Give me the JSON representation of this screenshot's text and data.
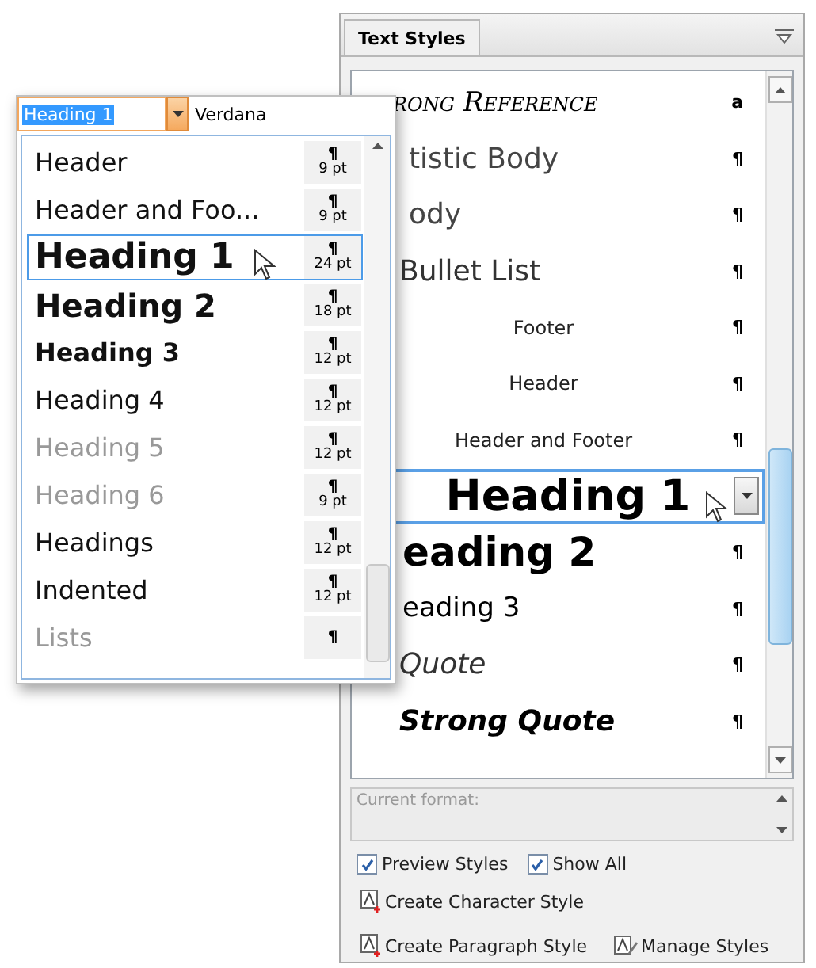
{
  "panel": {
    "title": "Text Styles",
    "rows": [
      {
        "kind": "small-caps",
        "text": "rong Reference",
        "mark": "a",
        "selected": false
      },
      {
        "kind": "light",
        "text": "tistic Body",
        "mark": "¶",
        "selected": false
      },
      {
        "kind": "light",
        "text": "ody",
        "mark": "¶",
        "selected": false
      },
      {
        "kind": "bullet",
        "text": "Bullet List",
        "mark": "¶",
        "selected": false
      },
      {
        "kind": "small",
        "text": "Footer",
        "mark": "¶",
        "selected": false
      },
      {
        "kind": "small",
        "text": "Header",
        "mark": "¶",
        "selected": false
      },
      {
        "kind": "small",
        "text": "Header and Footer",
        "mark": "¶",
        "selected": false
      },
      {
        "kind": "h1",
        "text": "Heading 1",
        "selected": true
      },
      {
        "kind": "h2",
        "text": "eading 2",
        "mark": "¶",
        "selected": false
      },
      {
        "kind": "h3",
        "text": "eading 3",
        "mark": "¶",
        "selected": false
      },
      {
        "kind": "quote",
        "text": "Quote",
        "mark": "¶",
        "selected": false
      },
      {
        "kind": "strong-quote",
        "text": "Strong Quote",
        "mark": "¶",
        "selected": false
      }
    ],
    "current_format": {
      "placeholder": "Current format:"
    },
    "checkboxes": [
      {
        "label": "Preview Styles",
        "checked": true
      },
      {
        "label": "Show All",
        "checked": true
      }
    ],
    "actions": [
      {
        "kind": "new",
        "label": "Create Character Style"
      },
      {
        "kind": "new",
        "label": "Create Paragraph Style"
      },
      {
        "kind": "manage",
        "label": "Manage Styles"
      }
    ]
  },
  "popup": {
    "style_field": {
      "value": "Heading 1"
    },
    "font_field": {
      "value": "Verdana"
    },
    "items": [
      {
        "kind": "plain",
        "name": "Header",
        "mark": "¶",
        "size": "9 pt",
        "dimmed": false,
        "selected": false
      },
      {
        "kind": "plain",
        "name": "Header and Foo...",
        "mark": "¶",
        "size": "9 pt",
        "dimmed": false,
        "selected": false
      },
      {
        "kind": "h1",
        "name": "Heading 1",
        "mark": "¶",
        "size": "24 pt",
        "dimmed": false,
        "selected": true
      },
      {
        "kind": "h2",
        "name": "Heading 2",
        "mark": "¶",
        "size": "18 pt",
        "dimmed": false,
        "selected": false
      },
      {
        "kind": "h3",
        "name": "Heading 3",
        "mark": "¶",
        "size": "12 pt",
        "dimmed": false,
        "selected": false
      },
      {
        "kind": "h4",
        "name": "Heading 4",
        "mark": "¶",
        "size": "12 pt",
        "dimmed": false,
        "selected": false
      },
      {
        "kind": "h4",
        "name": "Heading 5",
        "mark": "¶",
        "size": "12 pt",
        "dimmed": true,
        "selected": false
      },
      {
        "kind": "h4",
        "name": "Heading 6",
        "mark": "¶",
        "size": "9 pt",
        "dimmed": true,
        "selected": false
      },
      {
        "kind": "h4",
        "name": "Headings",
        "mark": "¶",
        "size": "12 pt",
        "dimmed": false,
        "selected": false
      },
      {
        "kind": "h4",
        "name": "Indented",
        "mark": "¶",
        "size": "12 pt",
        "dimmed": false,
        "selected": false
      },
      {
        "kind": "plain",
        "name": "Lists",
        "mark": "¶",
        "dimmed": true,
        "selected": false
      }
    ]
  }
}
